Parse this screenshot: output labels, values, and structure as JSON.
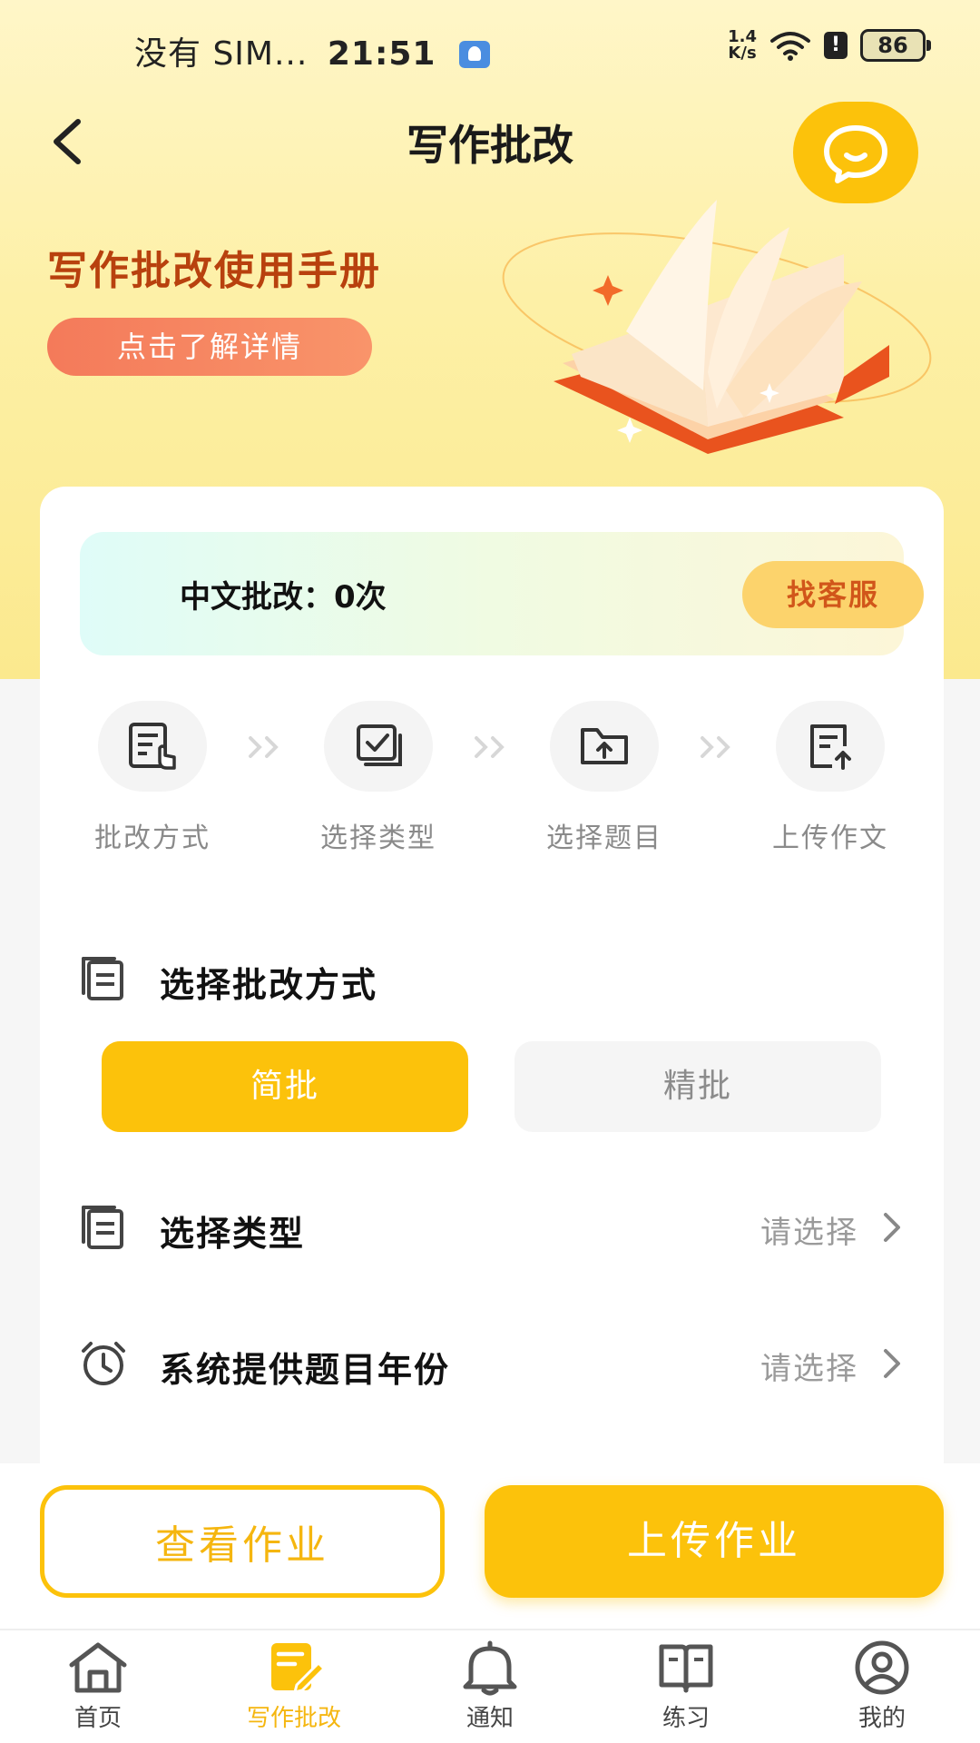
{
  "status_bar": {
    "carrier": "没有 SIM...",
    "time": "21:51",
    "net_speed_top": "1.4",
    "net_speed_bottom": "K/s",
    "battery": "86"
  },
  "header": {
    "title": "写作批改"
  },
  "banner": {
    "manual_title": "写作批改使用手册",
    "detail_button": "点击了解详情"
  },
  "quota": {
    "text": "中文批改：0次",
    "service_button": "找客服"
  },
  "steps": [
    {
      "label": "批改方式",
      "icon": "touch-document-icon"
    },
    {
      "label": "选择类型",
      "icon": "checkbox-stack-icon"
    },
    {
      "label": "选择题目",
      "icon": "folder-upload-icon"
    },
    {
      "label": "上传作文",
      "icon": "document-upload-icon"
    }
  ],
  "mode_section": {
    "title": "选择批改方式",
    "options": [
      "简批",
      "精批"
    ],
    "selected": "简批"
  },
  "type_section": {
    "title": "选择类型",
    "value": "请选择"
  },
  "year_section": {
    "title": "系统提供题目年份",
    "value": "请选择"
  },
  "actions": {
    "view": "查看作业",
    "upload": "上传作业"
  },
  "tabs": [
    {
      "label": "首页",
      "icon": "home-icon"
    },
    {
      "label": "写作批改",
      "icon": "edit-note-icon",
      "active": true
    },
    {
      "label": "通知",
      "icon": "bell-icon"
    },
    {
      "label": "练习",
      "icon": "book-open-icon"
    },
    {
      "label": "我的",
      "icon": "user-circle-icon"
    }
  ],
  "colors": {
    "accent": "#fcc20b",
    "manual_title": "#b8410e",
    "service_text": "#d1561a"
  }
}
